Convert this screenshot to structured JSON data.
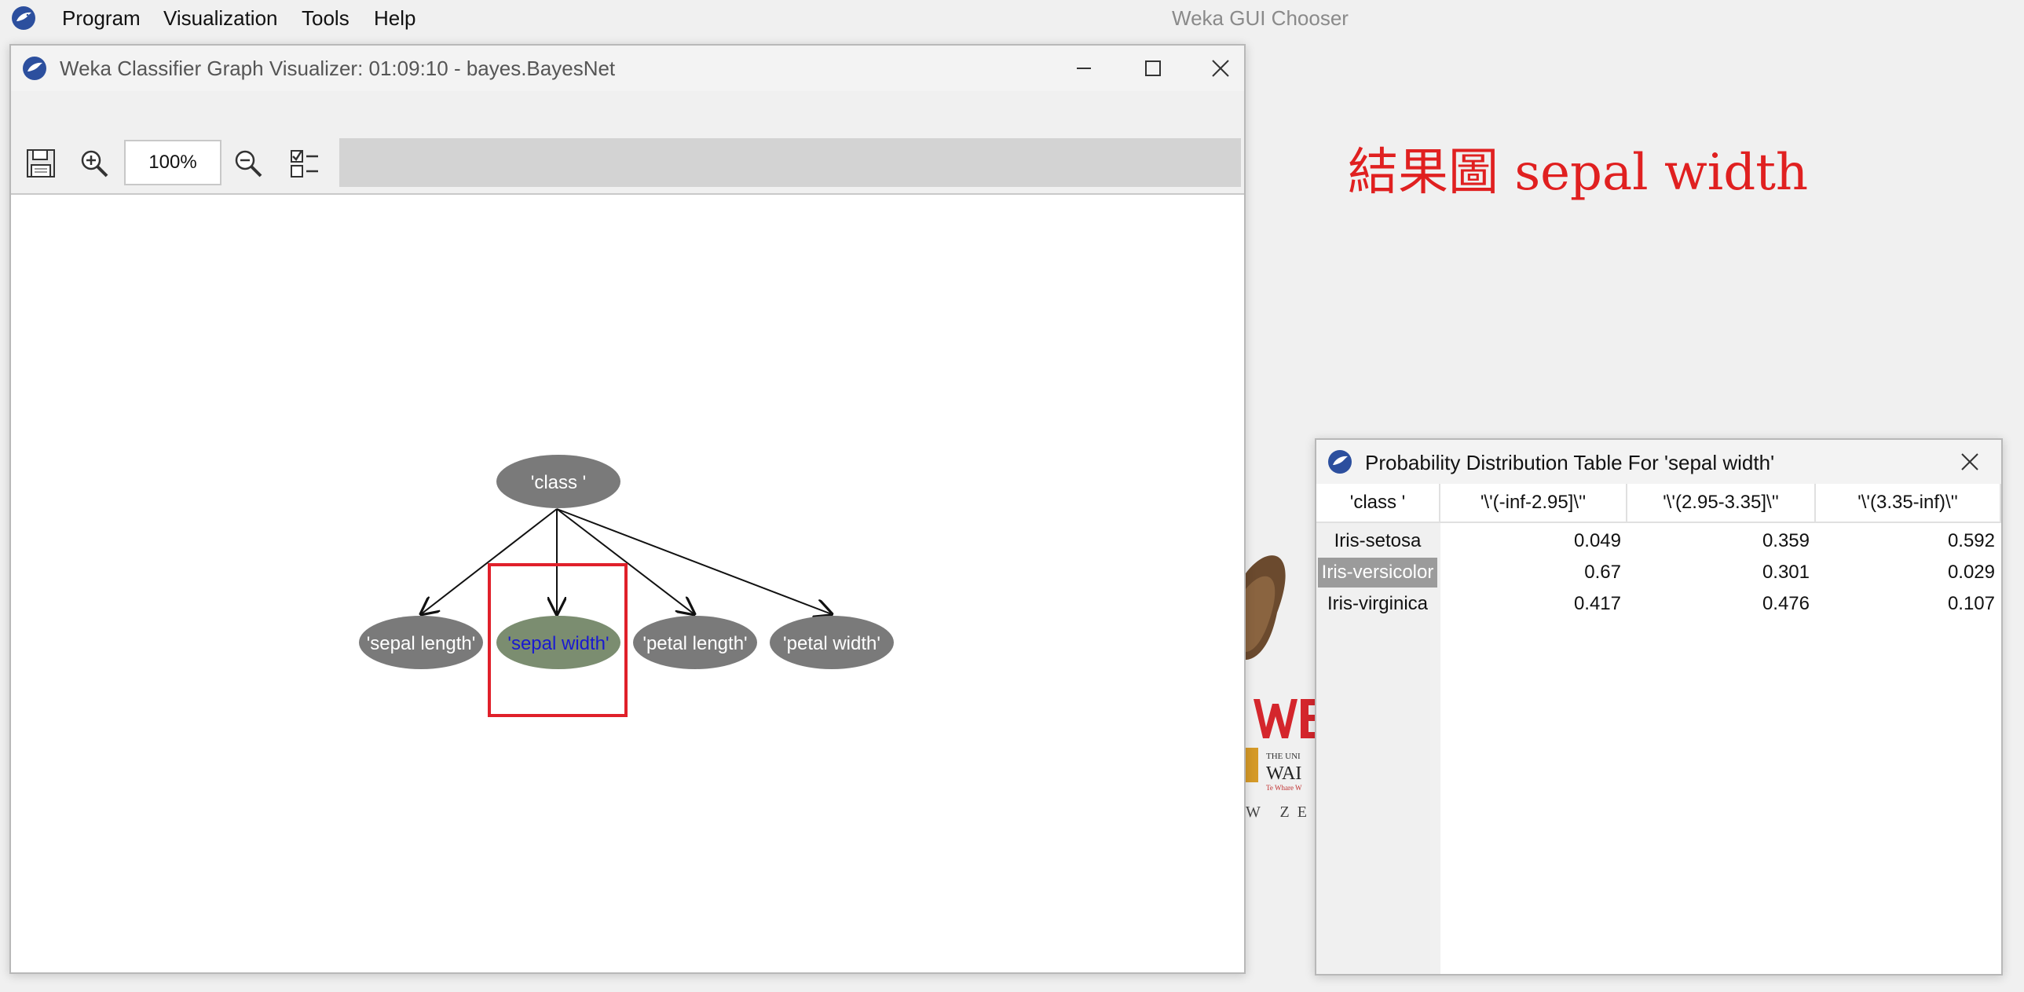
{
  "menubar": {
    "items": [
      "Program",
      "Visualization",
      "Tools",
      "Help"
    ],
    "chooser_title": "Weka GUI Chooser"
  },
  "annotation": "結果圖 sepal width",
  "visualizer": {
    "title": "Weka Classifier Graph Visualizer: 01:09:10 - bayes.BayesNet",
    "zoom": "100%",
    "nodes": {
      "class": "'class '",
      "sepal_length": "'sepal length'",
      "sepal_width": "'sepal width'",
      "petal_length": "'petal length'",
      "petal_width": "'petal width'"
    },
    "colors": {
      "node": "#7a7a7a",
      "selected_node": "#7b8d70",
      "selected_text": "#1a1ad0",
      "highlight_box": "#e0202a"
    }
  },
  "prob_table": {
    "title": "Probability Distribution Table For 'sepal width'",
    "header": [
      "'class '",
      "'\\'(-inf-2.95]\\''",
      "'\\'(2.95-3.35]\\''",
      "'\\'(3.35-inf)\\''"
    ],
    "rows": [
      {
        "label": "Iris-setosa",
        "values": [
          "0.049",
          "0.359",
          "0.592"
        ]
      },
      {
        "label": "Iris-versicolor",
        "values": [
          "0.67",
          "0.301",
          "0.029"
        ]
      },
      {
        "label": "Iris-virginica",
        "values": [
          "0.417",
          "0.476",
          "0.107"
        ]
      }
    ]
  }
}
